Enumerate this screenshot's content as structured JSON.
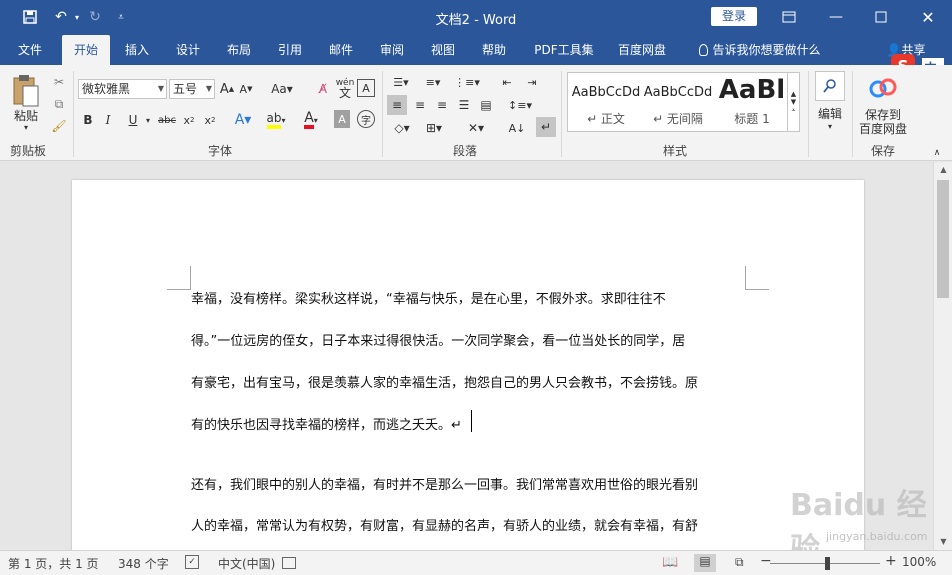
{
  "titlebar": {
    "title": "文档2  -  Word",
    "login": "登录"
  },
  "tabs": [
    "文件",
    "开始",
    "插入",
    "设计",
    "布局",
    "引用",
    "邮件",
    "审阅",
    "视图",
    "帮助",
    "PDF工具集",
    "百度网盘",
    "告诉我你想要做什么",
    "共享"
  ],
  "active_tab": "开始",
  "ribbon": {
    "clipboard": {
      "paste": "粘贴",
      "label": "剪贴板"
    },
    "font": {
      "name": "微软雅黑",
      "size": "五号",
      "label": "字体",
      "wen": "wén",
      "wen_char": "文"
    },
    "paragraph": {
      "label": "段落"
    },
    "styles": {
      "label": "样式",
      "items": [
        {
          "sample": "AaBbCcDd",
          "name": "↵ 正文"
        },
        {
          "sample": "AaBbCcDd",
          "name": "↵ 无间隔"
        },
        {
          "sample": "AaBl",
          "name": "标题 1"
        }
      ]
    },
    "editing": {
      "label": "编辑"
    },
    "save": {
      "label1": "保存到",
      "label2": "百度网盘",
      "group": "保存"
    }
  },
  "document": {
    "lines": [
      "幸福，没有榜样。梁实秋这样说，“幸福与快乐，是在心里，不假外求。求即往往不",
      "得。”一位远房的侄女，日子本来过得很快活。一次同学聚会，看一位当处长的同学，居",
      "有豪宅，出有宝马，很是羡慕人家的幸福生活，抱怨自己的男人只会教书，不会捞钱。原",
      "有的快乐也因寻找幸福的榜样，而逃之夭夭。↵",
      "还有，我们眼中的别人的幸福，有时并不是那么一回事。我们常常喜欢用世俗的眼光看别",
      "人的幸福，常常认为有权势，有财富，有显赫的名声，有骄人的业绩，就会有幸福，有舒"
    ]
  },
  "status": {
    "page": "第 1 页，共 1 页",
    "words": "348 个字",
    "lang": "中文(中国)",
    "zoom": "100%",
    "zoom_value": 100
  },
  "watermark": {
    "text": "Baidu 经验",
    "url": "jingyan.baidu.com"
  },
  "colors": {
    "accent": "#2b579a",
    "ribbon": "#f3f3f3",
    "highlight": "#ffff00",
    "font_color": "#e81123"
  }
}
